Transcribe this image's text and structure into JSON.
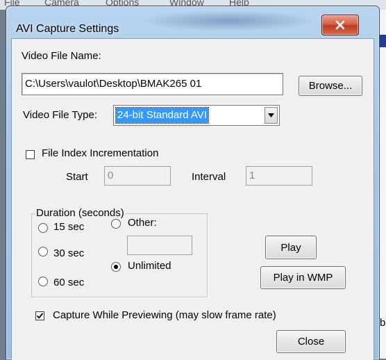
{
  "background": {
    "menubar": [
      "File",
      "Camera",
      "Options",
      "Window",
      "Help"
    ],
    "edge_fragment": "b"
  },
  "window": {
    "title": "AVI Capture Settings",
    "close_glyph": "X"
  },
  "video_file_name": {
    "label": "Video File Name:",
    "value": "C:\\Users\\vaulot\\Desktop\\BMAK265 01",
    "browse_label": "Browse..."
  },
  "video_file_type": {
    "label": "Video File Type:",
    "selected": "24-bit Standard AVI"
  },
  "file_index": {
    "label": "File Index Incrementation",
    "checked": false,
    "start_label": "Start",
    "start_value": "0",
    "interval_label": "Interval",
    "interval_value": "1"
  },
  "duration": {
    "legend": "Duration (seconds)",
    "options": [
      "15 sec",
      "30 sec",
      "60 sec"
    ],
    "other_label": "Other:",
    "other_value": "",
    "unlimited_label": "Unlimited",
    "selected": "Unlimited"
  },
  "buttons": {
    "play": "Play",
    "play_wmp": "Play in WMP",
    "close": "Close"
  },
  "capture_while_previewing": {
    "label": "Capture While Previewing (may slow frame rate)",
    "checked": true
  },
  "colors": {
    "selection": "#3399ff",
    "dialog_bg": "#f0f0f0",
    "close_button": "#c8442b"
  }
}
